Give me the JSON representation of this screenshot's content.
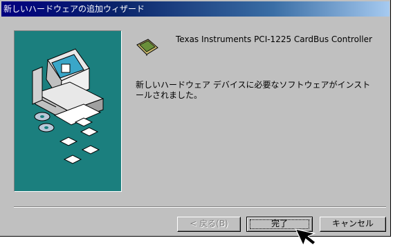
{
  "window": {
    "title": "新しいハードウェアの追加ウィザード"
  },
  "device": {
    "name": "Texas Instruments PCI-1225 CardBus Controller",
    "icon": "pc-card-icon"
  },
  "message": "新しいハードウェア デバイスに必要なソフトウェアがインストールされました。",
  "buttons": {
    "back": "< 戻る(B)",
    "finish": "完了",
    "cancel": "キャンセル"
  },
  "colors": {
    "title_bar": "#000080",
    "panel": "#1b7f7e",
    "face": "#c0c0c0"
  }
}
